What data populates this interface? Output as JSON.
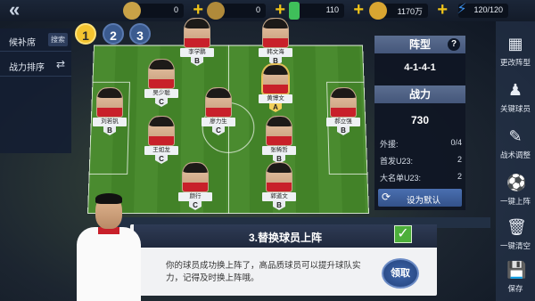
{
  "topbar": {
    "resources": [
      {
        "icon": "coin-icon",
        "value": "0",
        "color": "#c9a247"
      },
      {
        "icon": "gold-coin-icon",
        "value": "0",
        "color": "#b08a3a"
      },
      {
        "icon": "green-gem-icon",
        "value": "110",
        "color": "#3fbf5a"
      },
      {
        "icon": "gold-medal-icon",
        "value": "1170万",
        "color": "#d9a531"
      },
      {
        "icon": "energy-icon",
        "value": "120/120",
        "color": "#3a8ee8"
      }
    ]
  },
  "left_panel": {
    "bench_label": "候补席",
    "search_label": "搜索",
    "sort_label": "战力排序"
  },
  "tabs": [
    "1",
    "2",
    "3"
  ],
  "players": [
    {
      "name": "李学鹏",
      "pos": "B",
      "gold": false
    },
    {
      "name": "韩文海",
      "pos": "B",
      "gold": false
    },
    {
      "name": "吴少聪",
      "pos": "C",
      "gold": false
    },
    {
      "name": "黄博文",
      "pos": "A",
      "gold": true
    },
    {
      "name": "刘若钒",
      "pos": "B",
      "gold": false
    },
    {
      "name": "廖力生",
      "pos": "C",
      "gold": false
    },
    {
      "name": "郝立强",
      "pos": "B",
      "gold": false
    },
    {
      "name": "王如龙",
      "pos": "C",
      "gold": false
    },
    {
      "name": "张稀哲",
      "pos": "B",
      "gold": false
    },
    {
      "name": "颜行",
      "pos": "C",
      "gold": false
    },
    {
      "name": "郭道文",
      "pos": "B",
      "gold": false
    }
  ],
  "formation_panel": {
    "formation_header": "阵型",
    "help": "?",
    "formation_value": "4-1-4-1",
    "power_header": "战力",
    "power_value": "730",
    "stats": [
      {
        "label": "外援:",
        "value": "0/4"
      },
      {
        "label": "首发U23:",
        "value": "2"
      },
      {
        "label": "大名单U23:",
        "value": "2"
      }
    ],
    "set_default": "设为默认"
  },
  "right_sidebar": [
    {
      "label": "更改阵型",
      "icon": "formation-icon"
    },
    {
      "label": "关键球员",
      "icon": "key-player-icon"
    },
    {
      "label": "战术调整",
      "icon": "tactics-icon"
    },
    {
      "label": "一键上阵",
      "icon": "auto-lineup-icon"
    },
    {
      "label": "一键清空",
      "icon": "trash-icon"
    },
    {
      "label": "保存",
      "icon": "save-icon"
    }
  ],
  "dialog": {
    "title": "3.替换球员上阵",
    "body": "你的球员成功换上阵了，高品质球员可以提升球队实力，记得及时换上阵哦。",
    "claim": "领取"
  }
}
